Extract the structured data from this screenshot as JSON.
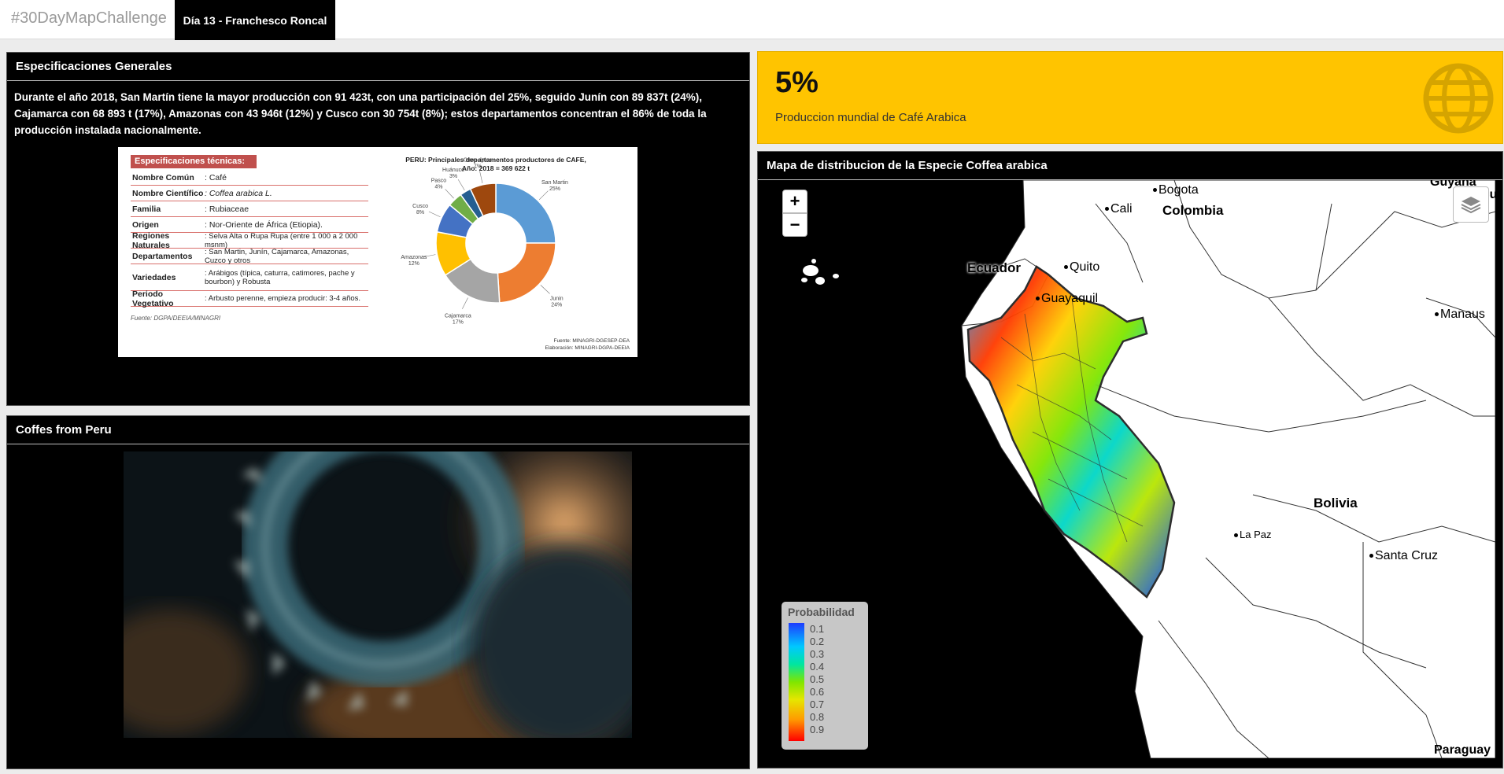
{
  "navbar": {
    "brand": "#30DayMapChallenge",
    "tab_label": "Día 13 - Franchesco Roncal"
  },
  "spec_panel": {
    "title": "Especificaciones Generales",
    "text": "Durante el año 2018, San Martín tiene la mayor producción con 91 423t, con una participación del 25%, seguido Junín con 89 837t (24%), Cajamarca con 68 893 t (17%), Amazonas con 43 946t (12%) y Cusco con 30 754t (8%); estos departamentos concentran el 86% de toda la producción instalada nacionalmente.",
    "figure": {
      "spec_title": "Especificaciones técnicas:",
      "rows": [
        {
          "label": "Nombre Común",
          "value": ": Café"
        },
        {
          "label": "Nombre Científico",
          "value": ": Coffea arabica L."
        },
        {
          "label": "Familia",
          "value": ": Rubiaceae"
        },
        {
          "label": "Origen",
          "value": ": Nor-Oriente de África (Etiopia)."
        },
        {
          "label": "Regiones Naturales",
          "value": ": Selva Alta o Rupa Rupa (entre 1 000 a 2 000 msnm)"
        },
        {
          "label": "Departamentos",
          "value": ": San Martin, Junín, Cajamarca, Amazonas, Cuzco y otros"
        },
        {
          "label": "Variedades",
          "value": ": Arábigos (típica, caturra, catimores, pache y bourbon) y Robusta"
        },
        {
          "label": "Periodo Vegetativo",
          "value": ": Arbusto perenne, empieza producir: 3-4 años."
        }
      ],
      "spec_source": "Fuente: DGPA/DEEIA/MINAGRI",
      "pie_title_line1": "PERU: Principales departamentos productores de CAFE,",
      "pie_title_line2": "Año: 2018 = 369 622 t",
      "pie_source_line1": "Fuente: MINAGRI-DGESEP-DEA",
      "pie_source_line2": "Elaboración: MINAGRI-DGPA-DEEIA"
    }
  },
  "chart_data": {
    "type": "pie",
    "title": "PERU: Principales departamentos productores de CAFE, Año: 2018 = 369 622 t",
    "categories": [
      "San Martin",
      "Junin",
      "Cajamarca",
      "Amazonas",
      "Cusco",
      "Pasco",
      "Huánuco",
      "Otros dptos"
    ],
    "values": [
      25,
      24,
      17,
      12,
      8,
      4,
      3,
      7
    ],
    "labels": [
      "San Martin\n25%",
      "Junin\n24%",
      "Cajamarca\n17%",
      "Amazonas\n12%",
      "Cusco\n8%",
      "Pasco\n4%",
      "Huánuco\n3%",
      "Otros dptos\n7%"
    ],
    "colors": [
      "#5b9bd5",
      "#ed7d31",
      "#a5a5a5",
      "#ffc000",
      "#4472c4",
      "#70ad47",
      "#255e91",
      "#9e480e"
    ]
  },
  "video_panel": {
    "title": "Coffes from Peru"
  },
  "kpi": {
    "value": "5%",
    "label": "Produccion mundial de Café Arabica",
    "icon": "globe-icon",
    "color": "#ffc400"
  },
  "map_panel": {
    "title": "Mapa de distribucion de la Especie Coffea arabica",
    "zoom_in": "+",
    "zoom_out": "−",
    "legend_title": "Probabilidad",
    "legend_labels": [
      "0.1",
      "0.2",
      "0.3",
      "0.4",
      "0.5",
      "0.6",
      "0.7",
      "0.8",
      "0.9"
    ],
    "cities": {
      "guyana": "Guyana",
      "su": "Su",
      "bogota": "Bogota",
      "cali": "Cali",
      "colombia": "Colombia",
      "ecuador": "Ecuador",
      "quito": "Quito",
      "guayaquil": "Guayaquil",
      "manaus": "Manaus",
      "bolivia": "Bolivia",
      "lapaz": "La Paz",
      "santacruz": "Santa Cruz",
      "paraguay": "Paraguay"
    }
  }
}
